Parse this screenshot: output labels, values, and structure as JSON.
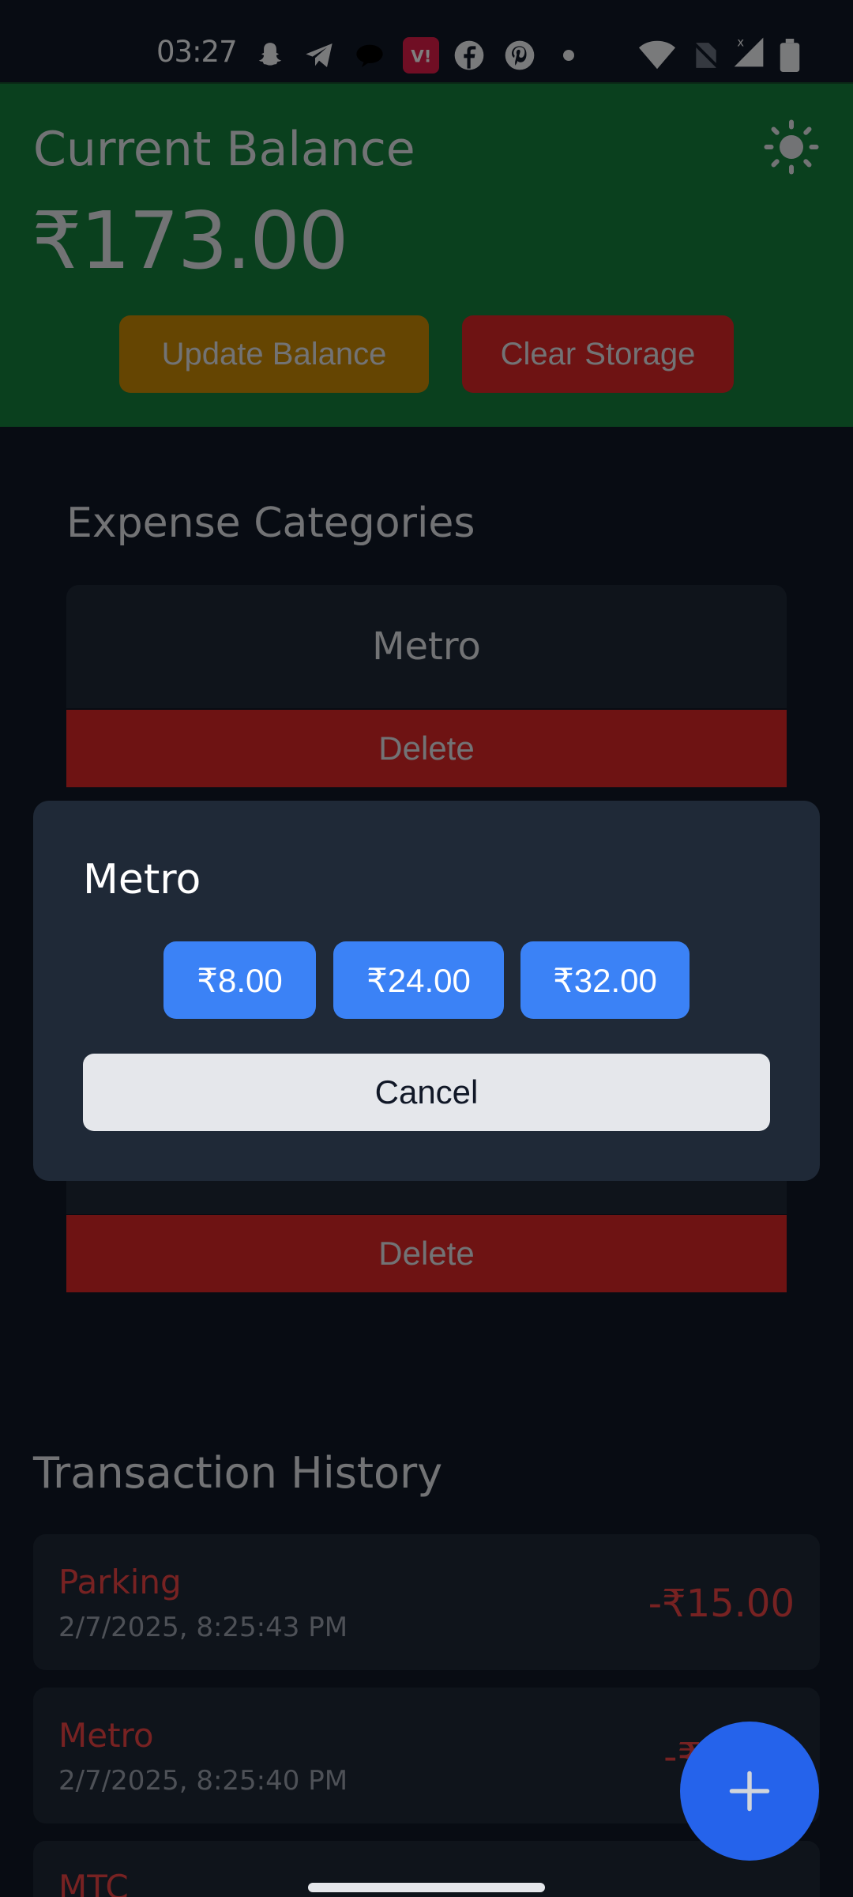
{
  "status_bar": {
    "time": "03:27",
    "icons": [
      "snapchat-icon",
      "telegram-icon",
      "chat-bubble-icon",
      "vi-icon",
      "facebook-icon",
      "pinterest-icon",
      "dot-icon",
      "wifi-icon",
      "no-sim-icon",
      "signal-icon",
      "battery-icon"
    ]
  },
  "header": {
    "balance_label": "Current Balance",
    "balance_amount": "₹173.00",
    "update_label": "Update Balance",
    "clear_label": "Clear Storage",
    "theme_icon": "sun-icon"
  },
  "categories": {
    "title": "Expense Categories",
    "items": [
      {
        "name": "Metro",
        "delete_label": "Delete"
      },
      {
        "name": "",
        "delete_label": "Delete"
      }
    ]
  },
  "transactions": {
    "title": "Transaction History",
    "items": [
      {
        "name": "Parking",
        "date": "2/7/2025, 8:25:43 PM",
        "amount": "-₹15.00"
      },
      {
        "name": "Metro",
        "date": "2/7/2025, 8:25:40 PM",
        "amount": "-₹"
      },
      {
        "name": "MTC",
        "date": "",
        "amount": ""
      }
    ]
  },
  "modal": {
    "title": "Metro",
    "amounts": [
      "₹8.00",
      "₹24.00",
      "₹32.00"
    ],
    "cancel_label": "Cancel"
  },
  "fab": {
    "label": "+",
    "icon": "plus-icon"
  },
  "colors": {
    "header_bg": "#15803d",
    "update_btn": "#ca8a04",
    "danger": "#dc2626",
    "primary": "#3b82f6",
    "fab": "#2563eb"
  }
}
